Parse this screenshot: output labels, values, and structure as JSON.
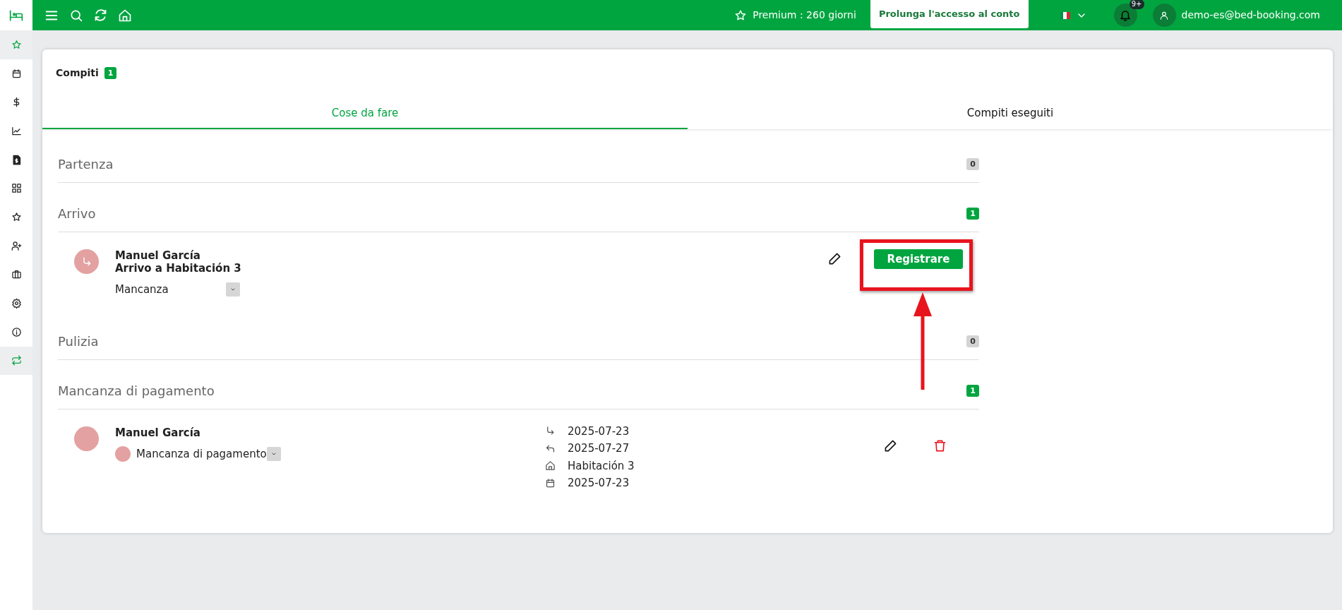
{
  "topbar": {
    "premium": "Premium : 260 giorni",
    "extend_button": "Prolunga l'accesso al conto",
    "notifications_badge": "9+",
    "user_email": "demo-es@bed-booking.com"
  },
  "sidebar": {
    "items": [
      {
        "selected": true
      },
      {
        "selected": false
      },
      {
        "selected": false
      },
      {
        "selected": false
      },
      {
        "selected": false
      },
      {
        "selected": false
      },
      {
        "selected": false
      },
      {
        "selected": false
      },
      {
        "selected": false
      },
      {
        "selected": false
      },
      {
        "selected": false
      },
      {
        "selected": true
      }
    ]
  },
  "card": {
    "title": "Compiti",
    "count": "1",
    "tabs": [
      {
        "label": "Cose da fare",
        "selected": true
      },
      {
        "label": "Compiti eseguiti",
        "selected": false
      }
    ],
    "sections": [
      {
        "title": "Partenza",
        "count": "0",
        "highlighted": false
      },
      {
        "title": "Arrivo",
        "count": "1",
        "highlighted": true,
        "tasks": [
          {
            "kind": "arrival",
            "name": "Manuel García",
            "subtitle": "Arrivo a Habitación 3",
            "status": "Mancanza",
            "action": "Registrare",
            "annotated": true
          }
        ]
      },
      {
        "title": "Pulizia",
        "count": "0",
        "highlighted": false
      },
      {
        "title": "Mancanza di pagamento",
        "count": "1",
        "highlighted": true,
        "tasks": [
          {
            "kind": "payment",
            "name": "Manuel García",
            "status": "Mancanza di pagamento",
            "details": [
              {
                "kind": "checkin",
                "text": "2025-07-23"
              },
              {
                "kind": "checkout",
                "text": "2025-07-27"
              },
              {
                "kind": "room",
                "text": "Habitación 3"
              },
              {
                "kind": "date",
                "text": "2025-07-23"
              }
            ]
          }
        ]
      }
    ]
  }
}
